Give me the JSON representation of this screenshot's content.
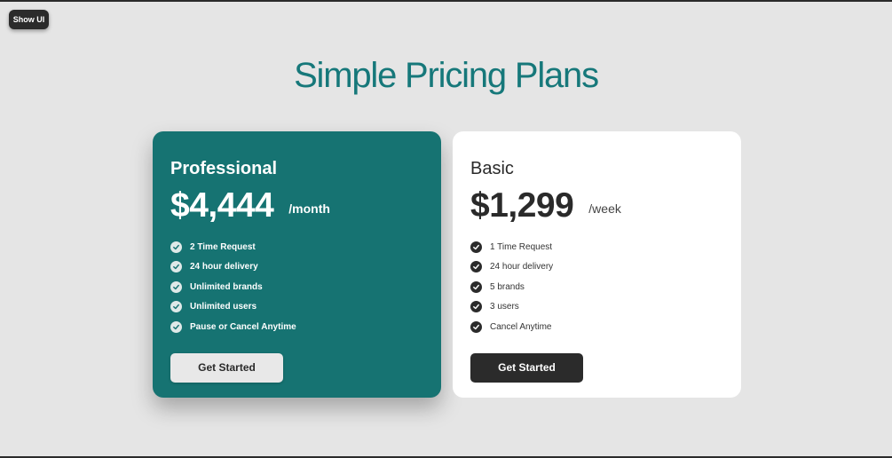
{
  "top_button": {
    "label": "Show UI"
  },
  "page": {
    "title": "Simple Pricing Plans"
  },
  "plans": [
    {
      "name": "Professional",
      "price": "$4,444",
      "period": "/month",
      "features": [
        "2 Time Request",
        "24 hour delivery",
        "Unlimited brands",
        "Unlimited users",
        "Pause or Cancel Anytime"
      ],
      "cta": "Get Started",
      "background_color": "#167372"
    },
    {
      "name": "Basic",
      "price": "$1,299",
      "period": "/week",
      "features": [
        "1 Time Request",
        "24 hour delivery",
        "5 brands",
        "3 users",
        "Cancel Anytime"
      ],
      "cta": "Get Started",
      "background_color": "#ffffff"
    }
  ],
  "colors": {
    "accent": "#16787a",
    "page_background": "#e5e5e5",
    "dark": "#2b2b2b"
  },
  "icons": {
    "feature_check": "check-circle-icon"
  }
}
